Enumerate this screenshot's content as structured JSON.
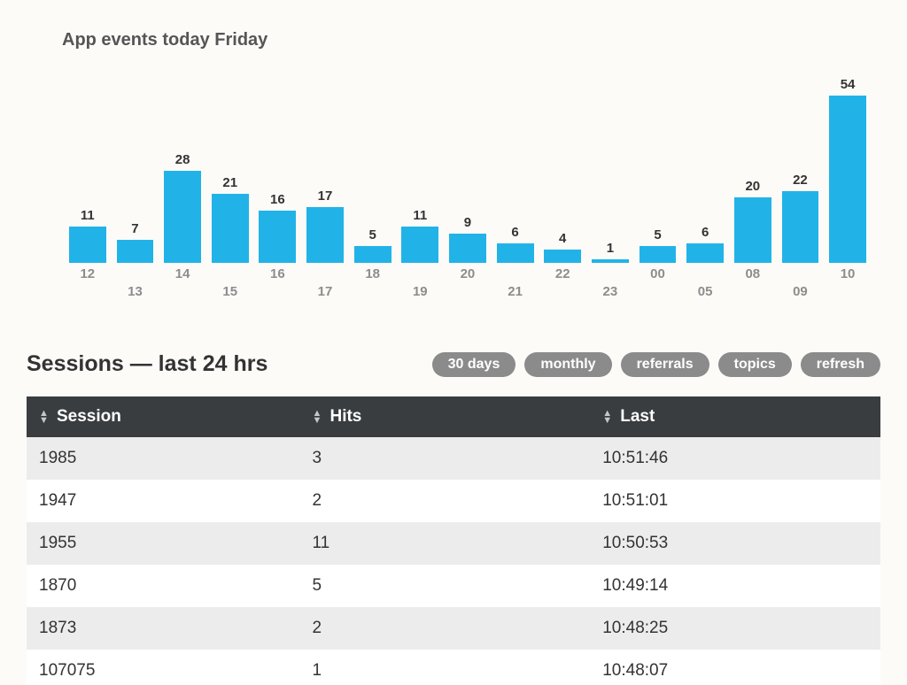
{
  "chart_data": {
    "type": "bar",
    "title": "App events today Friday",
    "categories": [
      "12",
      "13",
      "14",
      "15",
      "16",
      "17",
      "18",
      "19",
      "20",
      "21",
      "22",
      "23",
      "00",
      "05",
      "08",
      "09",
      "10"
    ],
    "values": [
      11,
      7,
      28,
      21,
      16,
      17,
      5,
      11,
      9,
      6,
      4,
      1,
      5,
      6,
      20,
      22,
      54
    ],
    "xlabel": "",
    "ylabel": "",
    "ylim": [
      0,
      54
    ]
  },
  "sessions": {
    "title": "Sessions — last 24 hrs",
    "buttons": [
      "30 days",
      "monthly",
      "referrals",
      "topics",
      "refresh"
    ],
    "columns": [
      "Session",
      "Hits",
      "Last"
    ],
    "rows": [
      {
        "session": "1985",
        "hits": "3",
        "last": "10:51:46"
      },
      {
        "session": "1947",
        "hits": "2",
        "last": "10:51:01"
      },
      {
        "session": "1955",
        "hits": "11",
        "last": "10:50:53"
      },
      {
        "session": "1870",
        "hits": "5",
        "last": "10:49:14"
      },
      {
        "session": "1873",
        "hits": "2",
        "last": "10:48:25"
      },
      {
        "session": "107075",
        "hits": "1",
        "last": "10:48:07"
      }
    ]
  }
}
